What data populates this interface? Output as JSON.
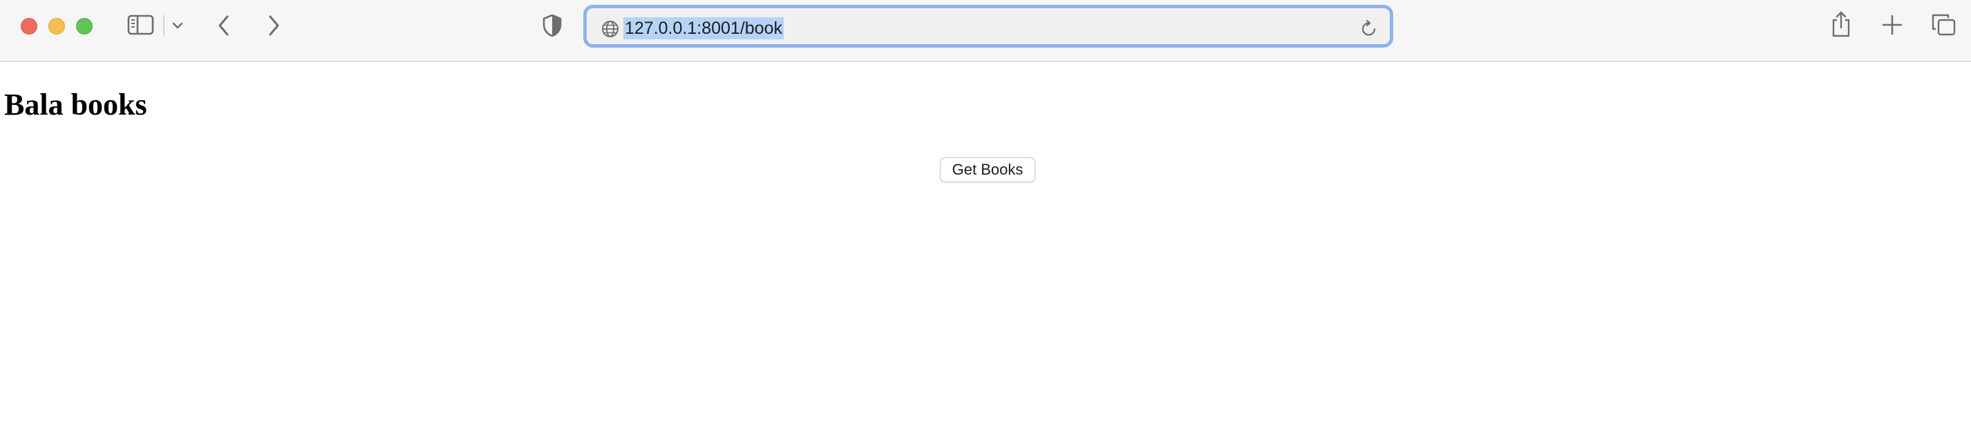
{
  "browser": {
    "address_bar": {
      "url": "127.0.0.1:8001/book",
      "selected": true
    },
    "icons": {
      "close": "close-button",
      "minimize": "minimize-button",
      "maximize": "maximize-button",
      "sidebar": "sidebar-icon",
      "tab_group_menu": "chevron-down-icon",
      "back": "chevron-left-icon",
      "forward": "chevron-right-icon",
      "privacy": "shield-icon",
      "site": "globe-icon",
      "reload": "reload-icon",
      "share": "share-icon",
      "new_tab": "plus-icon",
      "tab_overview": "tabs-overview-icon"
    },
    "colors": {
      "focus_ring": "#8fb3ea",
      "selection": "#b5d2f7",
      "close": "#ee6a5f",
      "minimize": "#f5bd4f",
      "maximize": "#62c555"
    }
  },
  "page": {
    "heading": "Bala books",
    "get_books_button": "Get Books"
  }
}
